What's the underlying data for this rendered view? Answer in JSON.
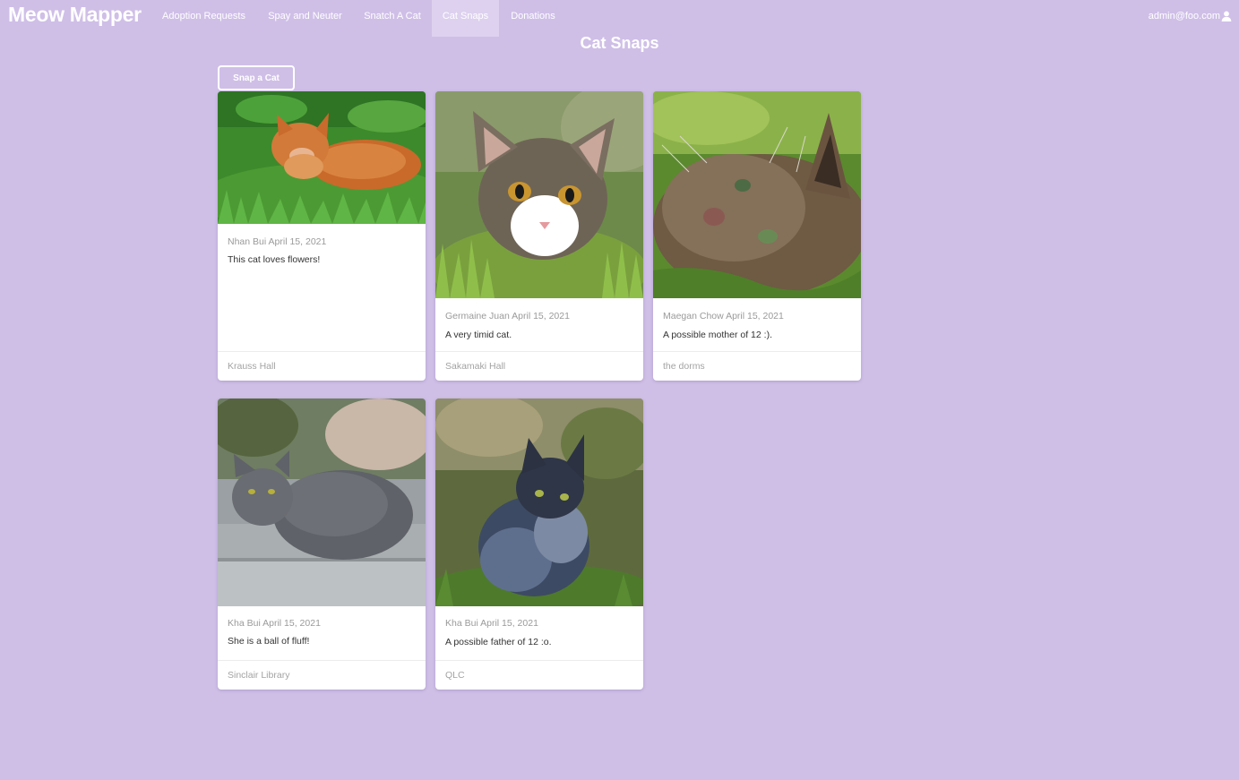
{
  "nav": {
    "brand": "Meow Mapper",
    "items": [
      {
        "label": "Adoption Requests"
      },
      {
        "label": "Spay and Neuter"
      },
      {
        "label": "Snatch A Cat"
      },
      {
        "label": "Cat Snaps"
      },
      {
        "label": "Donations"
      }
    ],
    "active_item": "Cat Snaps",
    "user_email": "admin@foo.com",
    "user_icon": "user-icon"
  },
  "page": {
    "title": "Cat Snaps",
    "snap_button_label": "Snap a Cat"
  },
  "cards": [
    {
      "author": "Nhan Bui",
      "date": "April 15, 2021",
      "description": "This cat loves flowers!",
      "location": "Krauss Hall"
    },
    {
      "author": "Germaine Juan",
      "date": "April 15, 2021",
      "description": "A very timid cat.",
      "location": "Sakamaki Hall"
    },
    {
      "author": "Maegan Chow",
      "date": "April 15, 2021",
      "description": "A possible mother of 12 :).",
      "location": "the dorms"
    },
    {
      "author": "Kha Bui",
      "date": "April 15, 2021",
      "description": "She is a ball of fluff!",
      "location": "Sinclair Library"
    },
    {
      "author": "Kha Bui",
      "date": "April 15, 2021",
      "description": "A possible father of 12 :o.",
      "location": "QLC"
    }
  ],
  "colors": {
    "background": "#cfbfe7",
    "nav_active": "#ddd1ef",
    "card": "#ffffff"
  }
}
